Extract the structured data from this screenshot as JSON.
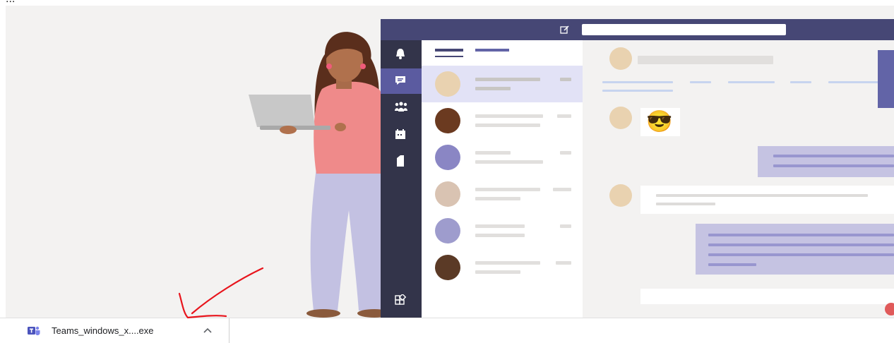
{
  "page": {
    "top_text": "...",
    "colors": {
      "teams_purple": "#464775",
      "rail": "#33344a",
      "stage_bg": "#f3f2f1",
      "annotation_red": "#e8141c"
    }
  },
  "teams_preview": {
    "search_placeholder": "",
    "rail_icons": [
      "activity-bell-icon",
      "chat-icon",
      "teams-icon",
      "calendar-icon",
      "files-icon",
      "apps-icon"
    ],
    "active_rail": "chat-icon",
    "chat_rows": 6,
    "emoji": "😎"
  },
  "download_bar": {
    "filename": "Teams_windows_x....exe",
    "menu_icon": "chevron-up-icon",
    "file_icon": "teams-logo-icon"
  }
}
